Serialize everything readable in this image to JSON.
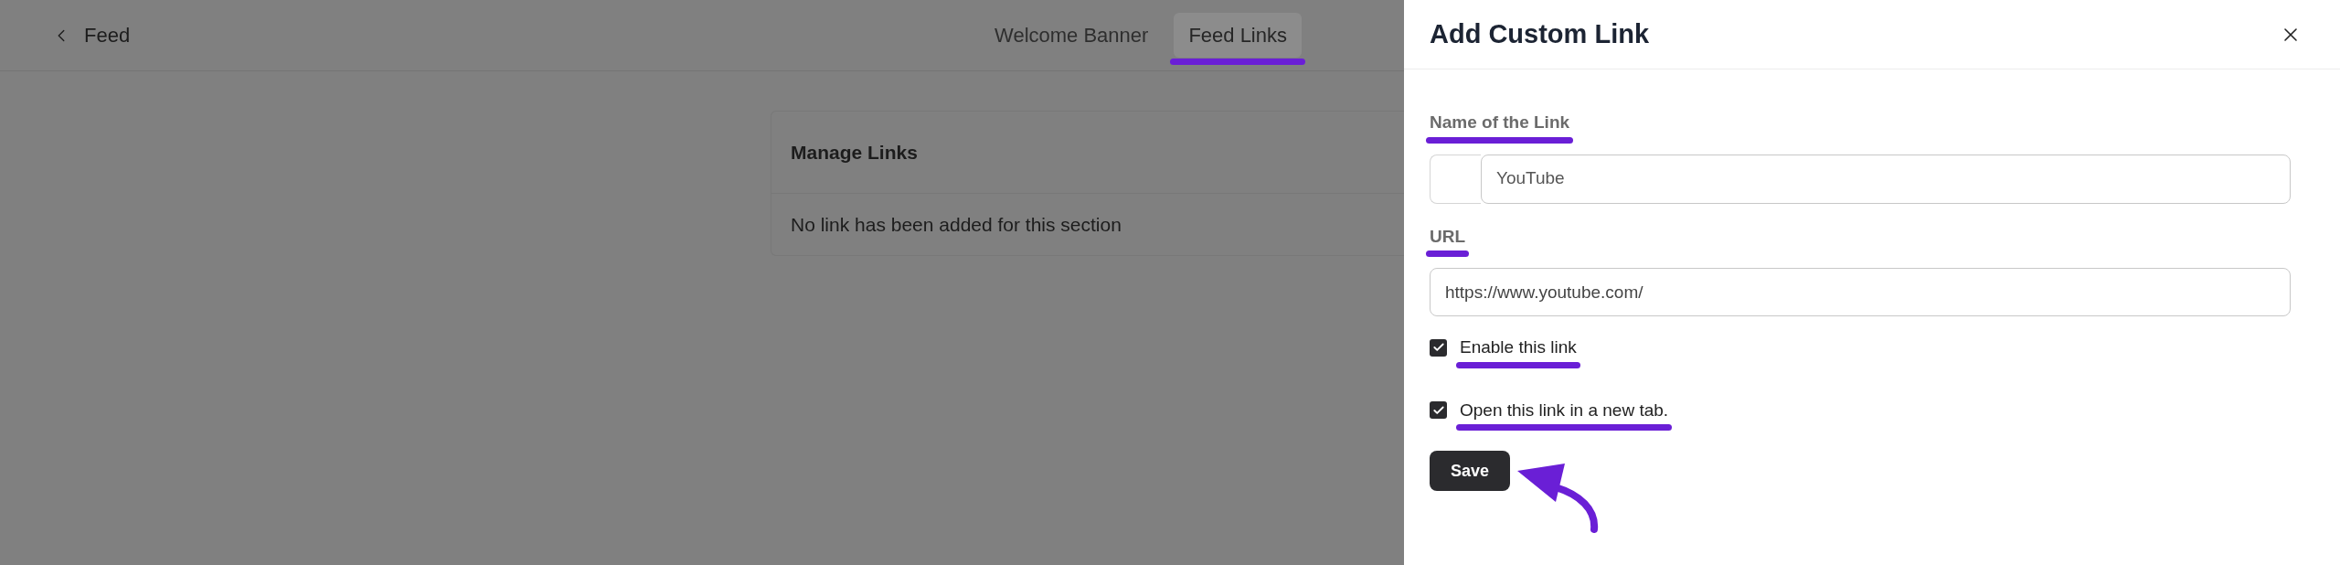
{
  "page": {
    "back_label": "Feed",
    "tabs": [
      {
        "label": "Welcome Banner",
        "selected": false
      },
      {
        "label": "Feed Links",
        "selected": true,
        "annotated": true
      }
    ],
    "card": {
      "title": "Manage Links",
      "empty_text": "No link has been added for this section"
    }
  },
  "drawer": {
    "title": "Add Custom Link",
    "name_field": {
      "label": "Name of the Link",
      "value": "YouTube",
      "annotated": true
    },
    "url_field": {
      "label": "URL",
      "value": "https://www.youtube.com/",
      "annotated": true
    },
    "options": [
      {
        "label": "Enable this link",
        "checked": true,
        "annotated": true
      },
      {
        "label": "Open this link in a new tab.",
        "checked": true,
        "annotated": true
      }
    ],
    "save_button": {
      "label": "Save",
      "annotated": true
    }
  }
}
